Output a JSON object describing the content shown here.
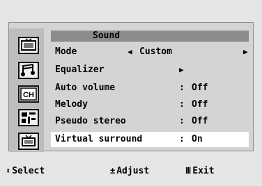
{
  "menu": {
    "title": "Sound",
    "rows": [
      {
        "label": "Mode",
        "value": "Custom",
        "left_arrow": "◀",
        "right_arrow": "▶"
      },
      {
        "label": "Equalizer",
        "right_arrow": "▶"
      },
      {
        "label": "Auto volume",
        "sep": ":",
        "value": "Off"
      },
      {
        "label": "Melody",
        "sep": ":",
        "value": "Off"
      },
      {
        "label": "Pseudo stereo",
        "sep": ":",
        "value": "Off"
      },
      {
        "label": "Virtual surround",
        "sep": ":",
        "value": "On"
      }
    ],
    "selected_row": "Virtual surround"
  },
  "sidebar": {
    "icons": [
      "picture-icon",
      "sound-icon",
      "channel-icon",
      "setup-icon",
      "input-icon"
    ],
    "channel_label": "CH"
  },
  "footer": {
    "select": {
      "glyph": "⬍",
      "label": "Select"
    },
    "adjust": {
      "glyph": "±",
      "label": "Adjust"
    },
    "exit": {
      "glyph": "Ⅲ",
      "label": "Exit"
    }
  }
}
